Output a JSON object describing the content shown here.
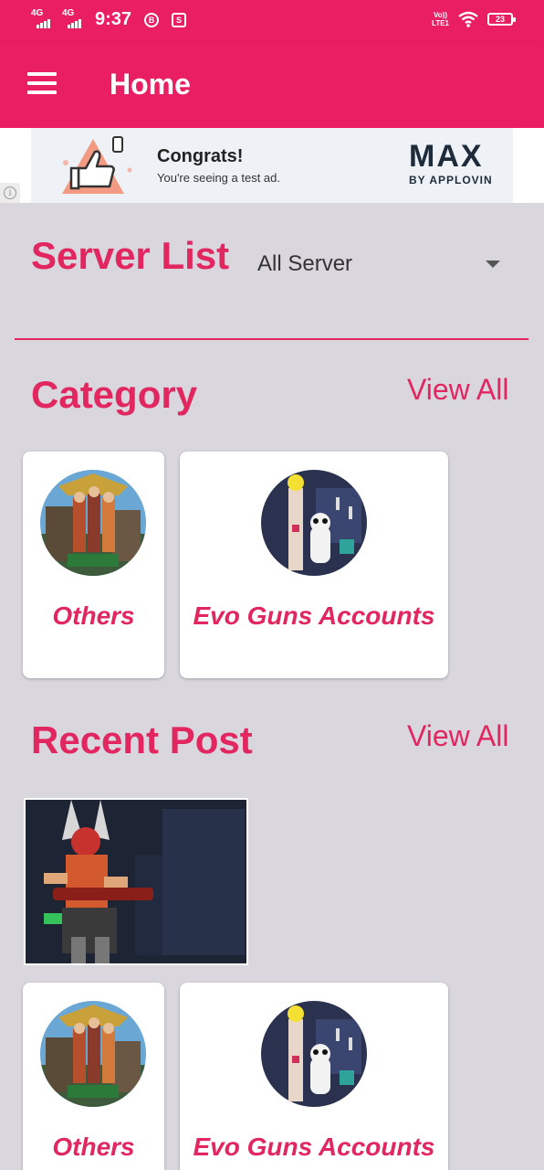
{
  "status_bar": {
    "network_1": "4G",
    "network_2": "4G",
    "time": "9:37",
    "notif_1": "B",
    "notif_2": "S",
    "volte_1": "Vo))",
    "volte_2": "LTE1",
    "battery": "23"
  },
  "app_bar": {
    "title": "Home",
    "menu_icon": "hamburger-menu-icon"
  },
  "ad": {
    "title": "Congrats!",
    "subtitle": "You're seeing a test ad.",
    "brand": "MAX",
    "brand_sub": "BY APPLOVIN",
    "info_glyph": "i"
  },
  "server": {
    "title": "Server List",
    "selected": "All Server"
  },
  "category": {
    "title": "Category",
    "view_all": "View All",
    "items": [
      {
        "label": "Others"
      },
      {
        "label": "Evo Guns Accounts"
      }
    ]
  },
  "recent": {
    "title": "Recent Post",
    "view_all": "View All",
    "items": [
      {
        "label": "Others"
      },
      {
        "label": "Evo Guns Accounts"
      }
    ]
  },
  "colors": {
    "accent": "#e91e63",
    "text_accent": "#e2265f",
    "background": "#d9d6de"
  }
}
